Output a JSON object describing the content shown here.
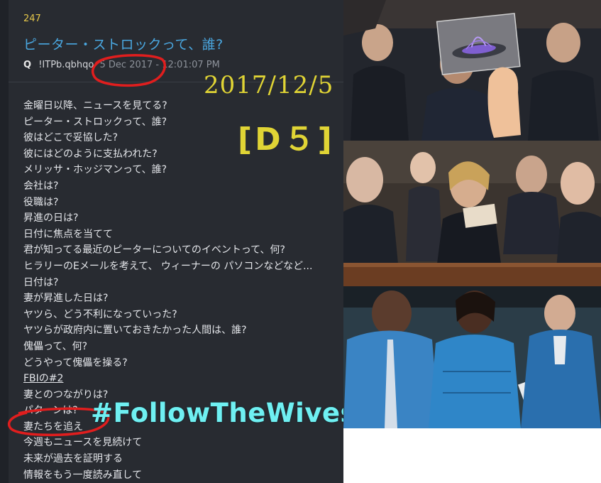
{
  "post": {
    "number": "247",
    "title": "ピーター・ストロックって、誰?",
    "author": "Q",
    "tripcode": "!ITPb.qbhqo",
    "timestamp": "5 Dec 2017 - 12:01:07 PM",
    "lines": [
      "金曜日以降、ニュースを見てる?",
      "ピーター・ストロックって、誰?",
      "彼はどこで妥協した?",
      "彼にはどのように支払われた?",
      "メリッサ・ホッジマンって、誰?",
      "会社は?",
      "役職は?",
      "昇進の日は?",
      "日付に焦点を当てて",
      "君が知ってる最近のピーターについてのイベントって、何?",
      "ヒラリーのEメールを考えて、 ウィーナーの パソコンなどなど...",
      "日付は?",
      "妻が昇進した日は?",
      "ヤツら、どう不利になっていった?",
      "ヤツらが政府内に置いておきたかった人間は、誰?",
      "傀儡って、何?",
      "どうやって傀儡を操る?",
      "FBIの#2",
      "妻とのつながりは?",
      "パターンは?",
      "妻たちを追え",
      "今週もニュースを見続けて",
      "未来が過去を証明する",
      "情報をもう一度読み直して"
    ]
  },
  "overlays": {
    "date": "2017/12/5",
    "drop": "[D５]",
    "hashtag": "#FollowTheWives"
  },
  "colors": {
    "post_bg": "#282b31",
    "title": "#4aa7e0",
    "number": "#e6c84a",
    "overlay_yellow": "#e0d435",
    "hashtag_cyan": "#6ff0f2",
    "circle_red": "#e01e1e"
  },
  "photos": [
    {
      "name": "funeral-photo-with-card-inset"
    },
    {
      "name": "funeral-photo-card-reading"
    },
    {
      "name": "funeral-photo-blue-row"
    }
  ]
}
